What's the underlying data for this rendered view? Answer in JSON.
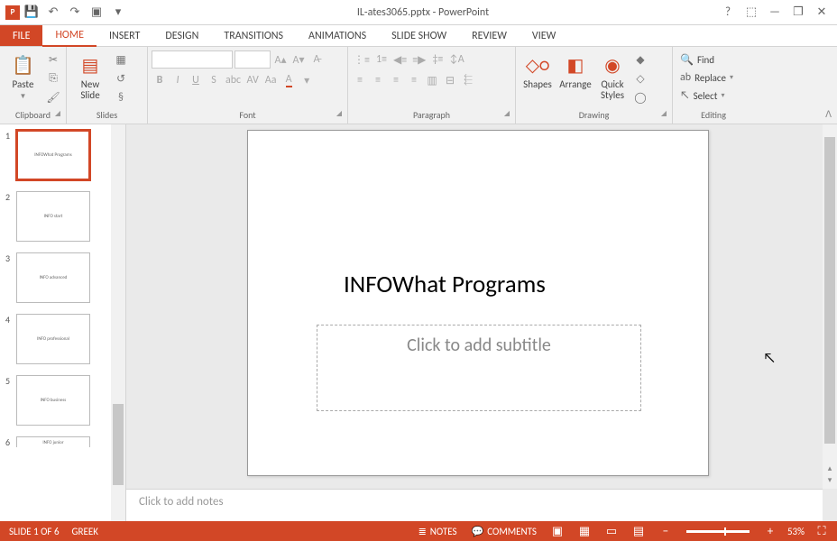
{
  "titlebar": {
    "app_icon": "P",
    "filename": "IL-ates3065.pptx - PowerPoint",
    "qat": {
      "save": "💾",
      "undo": "↶",
      "redo": "↷",
      "start": "▣",
      "more": "▾"
    },
    "win": {
      "help": "?",
      "ribbon": "⬚",
      "min": "—",
      "restore": "❐",
      "close": "✕"
    }
  },
  "tabs": {
    "file": "FILE",
    "home": "HOME",
    "insert": "INSERT",
    "design": "DESIGN",
    "transitions": "TRANSITIONS",
    "animations": "ANIMATIONS",
    "slideshow": "SLIDE SHOW",
    "review": "REVIEW",
    "view": "VIEW"
  },
  "ribbon": {
    "clipboard": {
      "label": "Clipboard",
      "paste": "Paste"
    },
    "slides": {
      "label": "Slides",
      "new_slide": "New\nSlide"
    },
    "font": {
      "label": "Font"
    },
    "paragraph": {
      "label": "Paragraph"
    },
    "drawing": {
      "label": "Drawing",
      "shapes": "Shapes",
      "arrange": "Arrange",
      "quick": "Quick\nStyles"
    },
    "editing": {
      "label": "Editing",
      "find": "Find",
      "replace": "Replace",
      "select": "Select"
    }
  },
  "thumbs": [
    {
      "n": "1",
      "t": "INFOWhat Programs"
    },
    {
      "n": "2",
      "t": "INFO start"
    },
    {
      "n": "3",
      "t": "INFO advanced"
    },
    {
      "n": "4",
      "t": "INFO professional"
    },
    {
      "n": "5",
      "t": "INFO business"
    },
    {
      "n": "6",
      "t": "INFO junior"
    }
  ],
  "slide": {
    "title": "INFOWhat Programs",
    "subtitle_placeholder": "Click to add subtitle"
  },
  "notes": {
    "placeholder": "Click to add notes"
  },
  "status": {
    "slide": "SLIDE 1 OF 6",
    "lang": "GREEK",
    "notes": "NOTES",
    "comments": "COMMENTS",
    "zoom": "53%"
  }
}
